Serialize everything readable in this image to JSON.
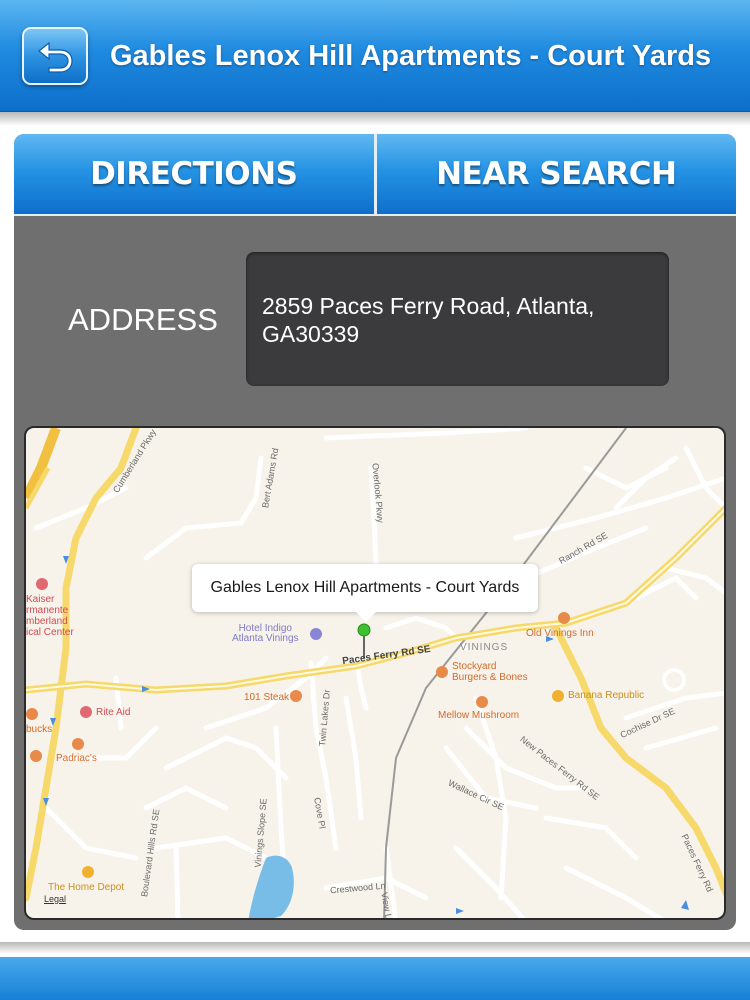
{
  "header": {
    "title": "Gables Lenox Hill Apartments - Court Yards",
    "back_icon": "back-arrow-icon"
  },
  "tabs": [
    {
      "label": "DIRECTIONS"
    },
    {
      "label": "NEAR SEARCH"
    }
  ],
  "address": {
    "label": "ADDRESS",
    "line1": "2859 Paces Ferry Road, Atlanta,",
    "line2": "GA30339"
  },
  "map": {
    "callout": "Gables Lenox Hill Apartments - Court Yards",
    "legal": "Legal",
    "roads": {
      "cumberland": "Cumberland Pkwy",
      "bert_adams": "Bert Adams Rd",
      "overlook": "Overlook Pkwy",
      "ranch": "Ranch Rd SE",
      "paces_ferry": "Paces Ferry Rd SE",
      "paces_ferry_right": "Paces Ferry Rd",
      "twin_lakes": "Twin Lakes Dr",
      "cove": "Cove Pl",
      "vinings_slope": "Vinings Slope SE",
      "boulevard_hills": "Boulevard Hills Rd SE",
      "crestwood": "Crestwood Ln",
      "view": "View Ln",
      "wallace": "Wallace Cir SE",
      "new_paces": "New Paces Ferry Rd SE",
      "cochise": "Cochise Dr SE"
    },
    "pois": {
      "kaiser": [
        "Kaiser",
        "rmanente",
        "mberland",
        "ical Center"
      ],
      "hotel_indigo": [
        "Hotel Indigo",
        "Atlanta Vinings"
      ],
      "old_vinings": "Old Vinings Inn",
      "vinings": "VININGS",
      "stockyard": [
        "Stockyard",
        "Burgers & Bones"
      ],
      "steak": "101 Steak",
      "mellow": "Mellow Mushroom",
      "banana": "Banana Republic",
      "rite_aid": "Rite Aid",
      "bucks": "bucks",
      "padriacs": "Padriac's",
      "home_depot": "The Home Depot"
    }
  }
}
